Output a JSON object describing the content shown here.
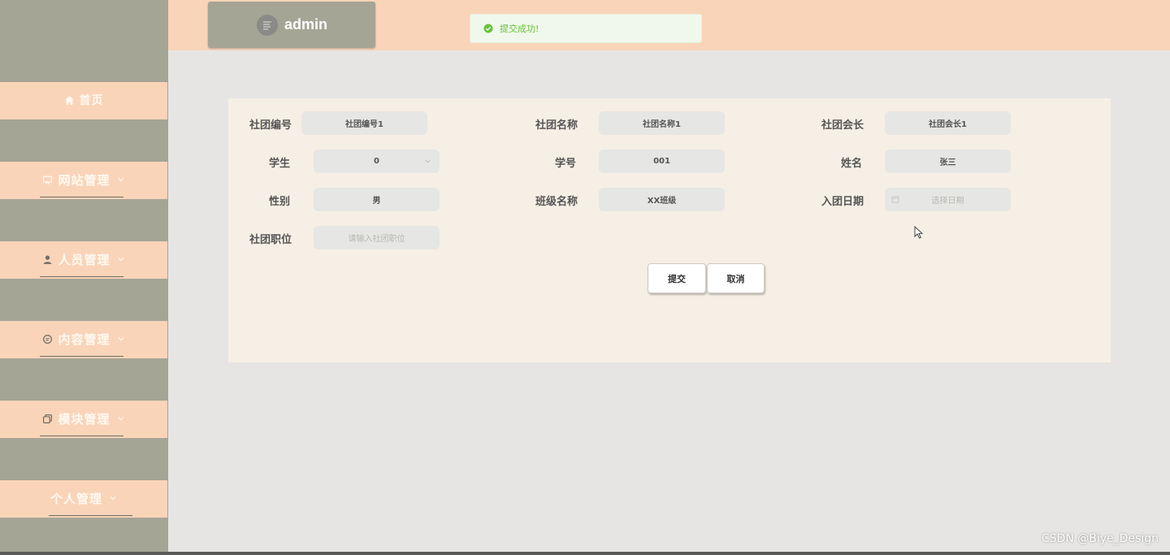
{
  "user": {
    "name": "admin"
  },
  "toast": {
    "message": "提交成功!"
  },
  "sidebar": {
    "items": [
      {
        "label": "首页",
        "icon": "home-icon"
      },
      {
        "label": "网站管理",
        "icon": "monitor-icon"
      },
      {
        "label": "人员管理",
        "icon": "person-icon"
      },
      {
        "label": "内容管理",
        "icon": "chat-icon"
      },
      {
        "label": "模块管理",
        "icon": "copy-icon"
      },
      {
        "label": "个人管理",
        "icon": ""
      }
    ]
  },
  "form": {
    "club_no": {
      "label": "社团编号",
      "value": "社团编号1"
    },
    "club_name": {
      "label": "社团名称",
      "value": "社团名称1"
    },
    "president": {
      "label": "社团会长",
      "value": "社团会长1"
    },
    "student": {
      "label": "学生",
      "value": "0"
    },
    "student_no": {
      "label": "学号",
      "value": "001"
    },
    "name": {
      "label": "姓名",
      "value": "张三"
    },
    "gender": {
      "label": "性别",
      "value": "男"
    },
    "class_name": {
      "label": "班级名称",
      "value": "XX班级"
    },
    "join_date": {
      "label": "入团日期",
      "placeholder": "选择日期"
    },
    "position": {
      "label": "社团职位",
      "placeholder": "请输入社团职位"
    }
  },
  "buttons": {
    "submit": "提交",
    "cancel": "取消"
  },
  "watermark": "CSDN @Biye_Design",
  "colors": {
    "sidebar_bg": "#a5a595",
    "accent_peach": "#fad4b8",
    "panel_bg": "#f6efe5",
    "success_green": "#67c23a"
  }
}
